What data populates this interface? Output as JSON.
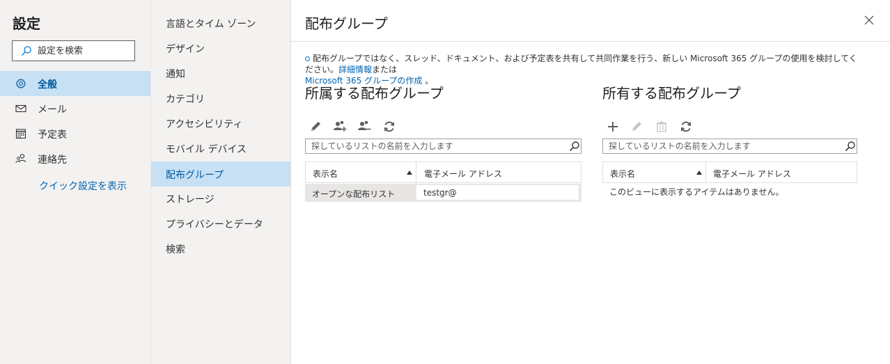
{
  "sidebar": {
    "title": "設定",
    "search_placeholder": "設定を検索",
    "items": [
      {
        "label": "全般",
        "icon": "gear-icon",
        "active": true
      },
      {
        "label": "メール",
        "icon": "mail-icon",
        "active": false
      },
      {
        "label": "予定表",
        "icon": "calendar-icon",
        "active": false
      },
      {
        "label": "連絡先",
        "icon": "people-icon",
        "active": false
      }
    ],
    "quick_settings_link": "クイック設定を表示"
  },
  "subnav": {
    "items": [
      {
        "label": "言語とタイム ゾーン"
      },
      {
        "label": "デザイン"
      },
      {
        "label": "通知"
      },
      {
        "label": "カテゴリ"
      },
      {
        "label": "アクセシビリティ"
      },
      {
        "label": "モバイル デバイス"
      },
      {
        "label": "配布グループ",
        "active": true
      },
      {
        "label": "ストレージ"
      },
      {
        "label": "プライバシーとデータ"
      },
      {
        "label": "検索"
      }
    ]
  },
  "panel": {
    "title": "配布グループ",
    "info_text": "配布グループではなく、スレッド、ドキュメント、および予定表を共有して共同作業を行う、新しい Microsoft 365 グループの使用を検討してください。",
    "info_link_details": "詳細情報",
    "info_or": "または",
    "info_link_create": "Microsoft 365 グループの作成",
    "info_period": "。",
    "member_of": {
      "title": "所属する配布グループ",
      "search_placeholder": "探しているリストの名前を入力します",
      "col_name": "表示名",
      "col_email": "電子メール アドレス",
      "rows": [
        {
          "name": "オープンな配布リスト",
          "email": "testgr@"
        }
      ]
    },
    "owned": {
      "title": "所有する配布グループ",
      "search_placeholder": "探しているリストの名前を入力します",
      "col_name": "表示名",
      "col_email": "電子メール アドレス",
      "empty": "このビューに表示するアイテムはありません。"
    }
  },
  "colors": {
    "accent": "#0078d4",
    "link": "#0063b1",
    "selected_bg": "#c7e0f4"
  }
}
